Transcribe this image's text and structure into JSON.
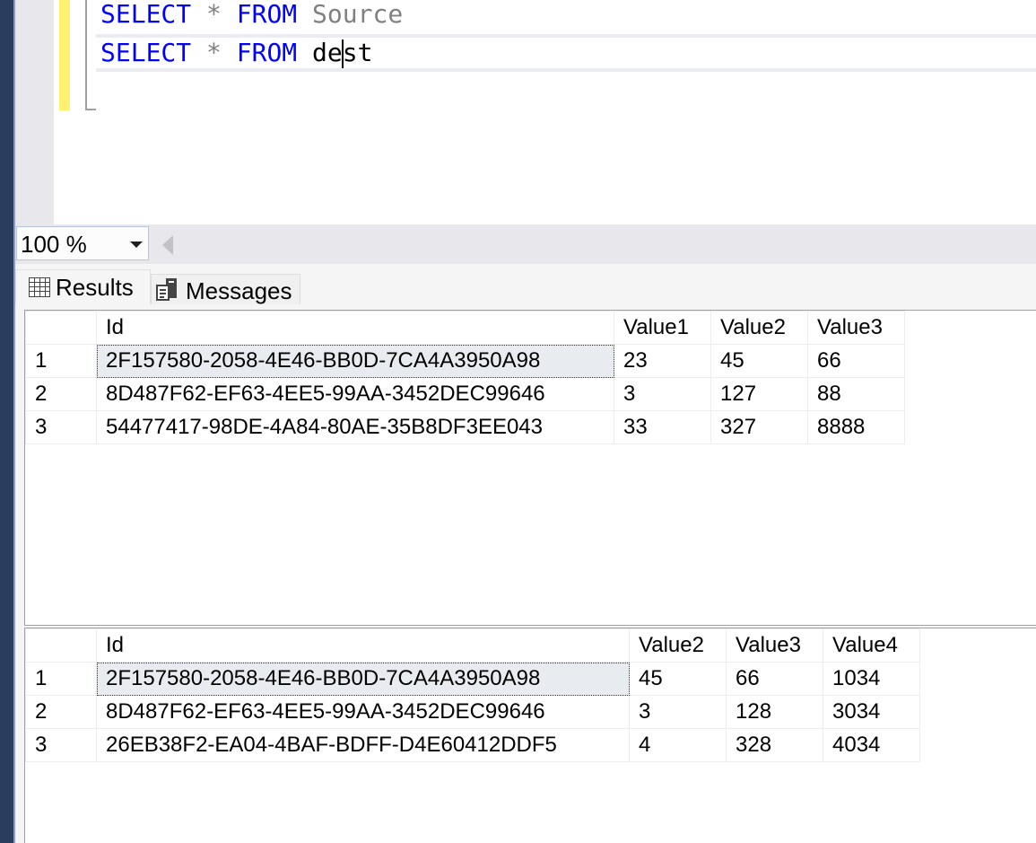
{
  "editor": {
    "lines": [
      {
        "keyword1": "SELECT",
        "op": "*",
        "keyword2": "FROM",
        "object": "Source"
      },
      {
        "keyword1": "SELECT",
        "op": "*",
        "keyword2": "FROM",
        "object_before_caret": "de",
        "object_after_caret": "st"
      }
    ]
  },
  "zoom": {
    "value": "100 %"
  },
  "tabs": [
    {
      "label": "Results",
      "icon": "grid-icon",
      "active": true
    },
    {
      "label": "Messages",
      "icon": "messages-icon",
      "active": false
    }
  ],
  "results": [
    {
      "columns": [
        "",
        "Id",
        "Value1",
        "Value2",
        "Value3"
      ],
      "rows": [
        [
          "1",
          "2F157580-2058-4E46-BB0D-7CA4A3950A98",
          "23",
          "45",
          "66"
        ],
        [
          "2",
          "8D487F62-EF63-4EE5-99AA-3452DEC99646",
          "3",
          "127",
          "88"
        ],
        [
          "3",
          "54477417-98DE-4A84-80AE-35B8DF3EE043",
          "33",
          "327",
          "8888"
        ]
      ]
    },
    {
      "columns": [
        "",
        "Id",
        "Value2",
        "Value3",
        "Value4"
      ],
      "rows": [
        [
          "1",
          "2F157580-2058-4E46-BB0D-7CA4A3950A98",
          "45",
          "66",
          "1034"
        ],
        [
          "2",
          "8D487F62-EF63-4EE5-99AA-3452DEC99646",
          "3",
          "128",
          "3034"
        ],
        [
          "3",
          "26EB38F2-EA04-4BAF-BDFF-D4E60412DDF5",
          "4",
          "328",
          "4034"
        ]
      ]
    }
  ],
  "colors": {
    "keyword": "#0000ff",
    "sidebar": "#2b3d5e",
    "change_bar": "#fff170"
  }
}
